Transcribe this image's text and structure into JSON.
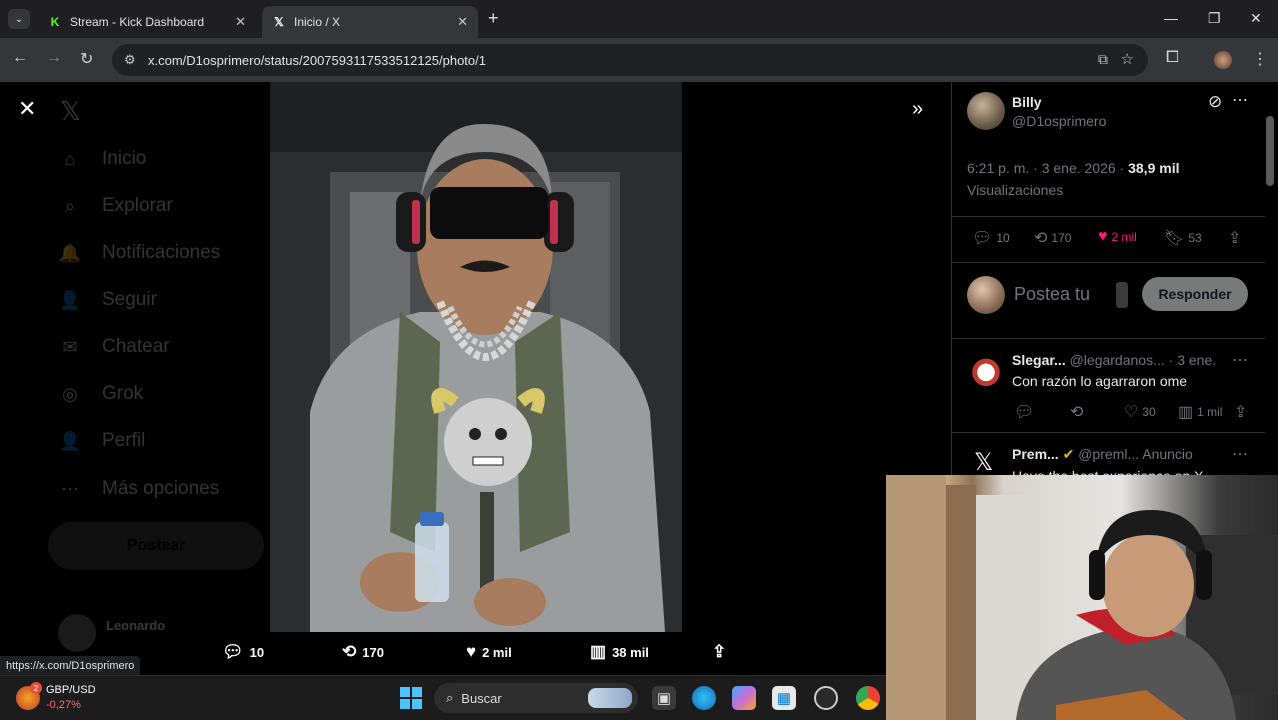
{
  "browser": {
    "tabs": [
      {
        "label": "Stream - Kick Dashboard",
        "favicon": "K"
      },
      {
        "label": "Inicio / X",
        "favicon": "X"
      }
    ],
    "new_tab": "+",
    "url": "x.com/D1osprimero/status/2007593117533512125/photo/1",
    "status_url": "https://x.com/D1osprimero"
  },
  "sidebar": {
    "items": [
      {
        "label": "Inicio",
        "icon": "⌂"
      },
      {
        "label": "Explorar",
        "icon": "⌕"
      },
      {
        "label": "Notificaciones",
        "icon": "🔔"
      },
      {
        "label": "Seguir",
        "icon": "👤"
      },
      {
        "label": "Chatear",
        "icon": "✉"
      },
      {
        "label": "Grok",
        "icon": "◎"
      },
      {
        "label": "Perfil",
        "icon": "👤"
      },
      {
        "label": "Más opciones",
        "icon": "⋯"
      }
    ],
    "post_button": "Postear",
    "account_name": "Leonardo"
  },
  "photo_actions": {
    "replies": "10",
    "reposts": "170",
    "likes": "2 mil",
    "views": "38 mil"
  },
  "tweet": {
    "author_name": "Billy",
    "author_handle": "@D1osprimero",
    "time": "6:21 p. m. · 3 ene. 2026 · ",
    "views_count": "38,9 mil",
    "views_label": "Visualizaciones",
    "replies": "10",
    "reposts": "170",
    "likes": "2 mil",
    "bookmarks": "53",
    "reply_placeholder": "Postea tu",
    "reply_button": "Responder"
  },
  "replies": [
    {
      "name": "Slegar...",
      "handle": "@legardanos...",
      "time": "· 3 ene.",
      "text": "Con razón lo agarraron ome",
      "replies": "",
      "reposts": "",
      "likes": "30",
      "views": "1 mil"
    }
  ],
  "ad": {
    "name": "Prem...",
    "handle": "@preml...",
    "label": "Anuncio",
    "text": "Have the best experience on X"
  },
  "taskbar": {
    "ticker_name": "GBP/USD",
    "ticker_change": "-0,27%",
    "ticker_badge": "2",
    "search_label": "Buscar"
  },
  "colors": {
    "like_active": "#f91880",
    "kick_green": "#53fc18",
    "ticker_red": "#ff6b6b"
  }
}
